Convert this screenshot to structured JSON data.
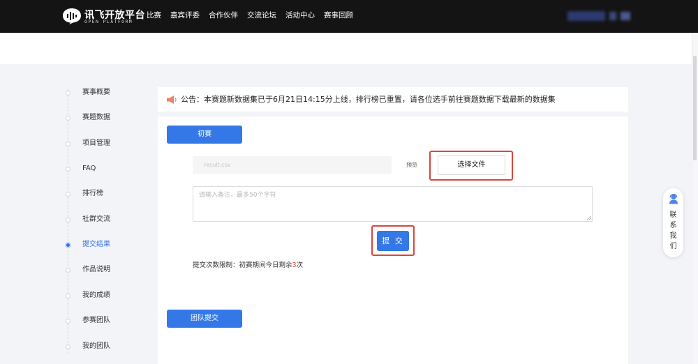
{
  "brand": {
    "name_cn": "讯飞开放平台",
    "name_en": "OPEN PLATFORM"
  },
  "nav": {
    "items": [
      "比赛",
      "嘉宾评委",
      "合作伙伴",
      "交流论坛",
      "活动中心",
      "赛事回顾"
    ]
  },
  "sidebar": {
    "items": [
      "赛事概要",
      "赛题数据",
      "项目管理",
      "FAQ",
      "排行榜",
      "社群交流",
      "提交结果",
      "作品说明",
      "我的成绩",
      "参赛团队",
      "我的团队"
    ],
    "active_index": 6
  },
  "notice": {
    "text": "公告：本赛题新数据集已于6月21日14:15分上线，排行榜已重置，请各位选手前往赛题数据下载最新的数据集"
  },
  "submission": {
    "stage_tab": "初赛",
    "file_placeholder": "result.csv",
    "preview_label": "预览",
    "select_file_label": "选择文件",
    "remark_placeholder": "请输入备注，最多50个字符",
    "submit_label": "提 交",
    "limit_prefix": "提交次数限制：初赛期间今日剩余",
    "limit_count": "3",
    "limit_suffix": "次",
    "team_submit_label": "团队提交"
  },
  "contact": {
    "chars": [
      "联",
      "系",
      "我",
      "们"
    ]
  },
  "colors": {
    "primary": "#3478e8",
    "highlight_border": "#d9463a",
    "topbar": "#141414",
    "notice_icon": "#e8826a"
  }
}
